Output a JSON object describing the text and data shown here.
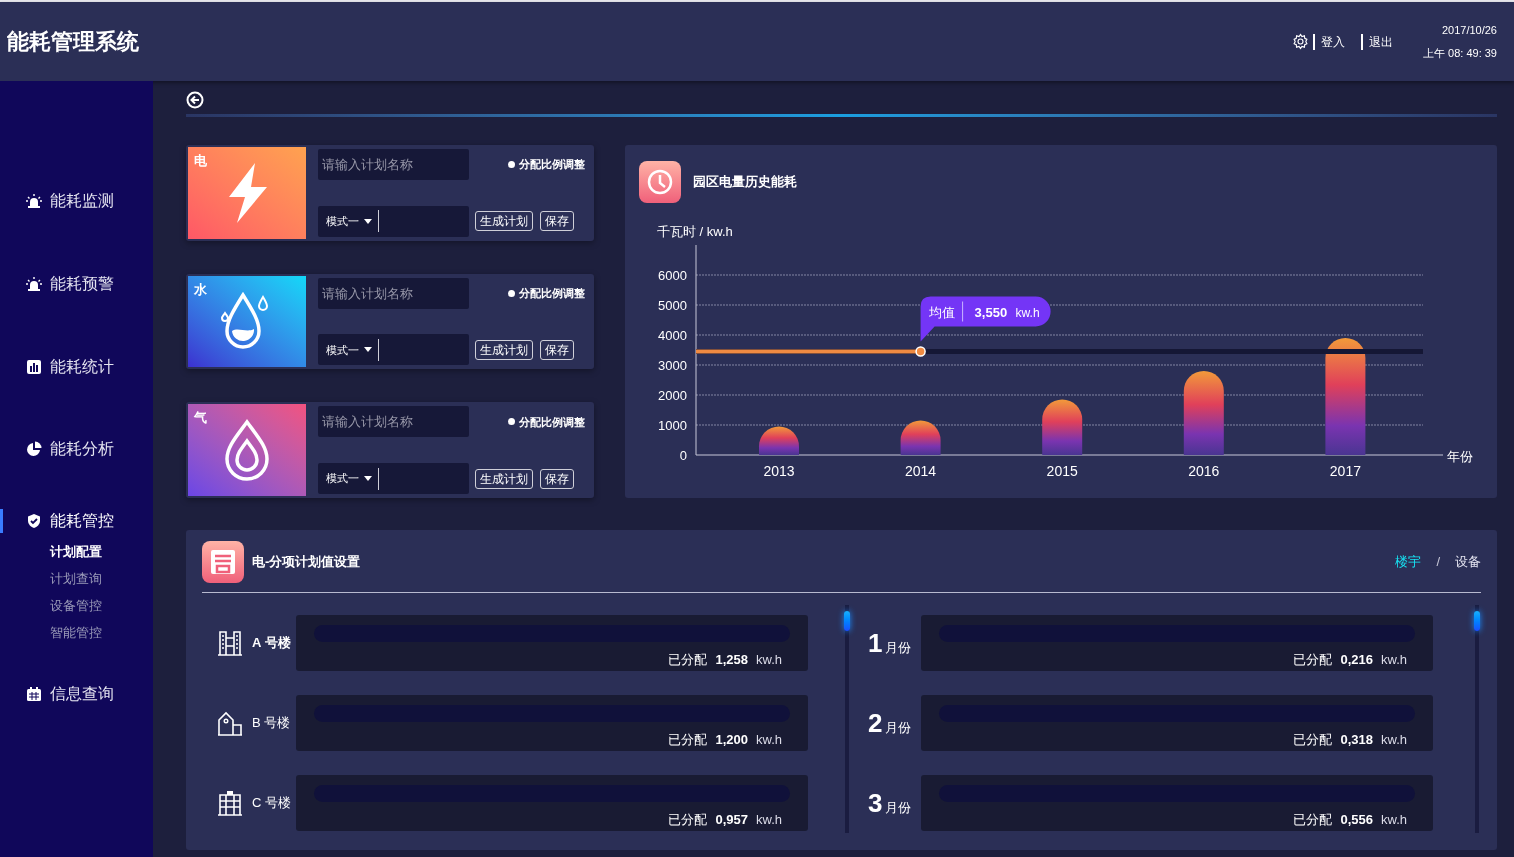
{
  "header": {
    "title": "能耗管理系统",
    "links": [
      "登入",
      "退出"
    ],
    "date": "2017/10/26",
    "time": "上午 08: 49: 39"
  },
  "sidebar": {
    "items": [
      {
        "label": "能耗监测",
        "selected": false
      },
      {
        "label": "能耗预警",
        "selected": false
      },
      {
        "label": "能耗统计",
        "selected": false
      },
      {
        "label": "能耗分析",
        "selected": false
      },
      {
        "label": "能耗管控",
        "selected": true,
        "children": [
          {
            "label": "计划配置",
            "selected": true
          },
          {
            "label": "计划查询",
            "selected": false
          },
          {
            "label": "设备管控",
            "selected": false
          },
          {
            "label": "智能管控",
            "selected": false
          }
        ]
      },
      {
        "label": "信息查询",
        "selected": false
      }
    ]
  },
  "plans": [
    {
      "kind": "electric",
      "tag": "电",
      "name_placeholder": "请输入计划名称",
      "option": {
        "label": "分配比例调整",
        "checked": true
      },
      "mode": "模式一",
      "buttons": [
        "生成计划",
        "保存"
      ]
    },
    {
      "kind": "water",
      "tag": "水",
      "name_placeholder": "请输入计划名称",
      "option": {
        "label": "分配比例调整",
        "checked": true
      },
      "mode": "模式一",
      "buttons": [
        "生成计划",
        "保存"
      ]
    },
    {
      "kind": "gas",
      "tag": "气",
      "name_placeholder": "请输入计划名称",
      "option": {
        "label": "分配比例调整",
        "checked": true
      },
      "mode": "模式一",
      "buttons": [
        "生成计划",
        "保存"
      ]
    }
  ],
  "history": {
    "title": "园区电量历史能耗",
    "chart_data": {
      "type": "bar",
      "ylabel": "千瓦时 / kw.h",
      "xlabel": "年份",
      "categories": [
        "2013",
        "2014",
        "2015",
        "2016",
        "2017"
      ],
      "values": [
        950,
        1150,
        1850,
        2800,
        3900
      ],
      "ylim": [
        0,
        6000
      ],
      "yticks": [
        0,
        1000,
        2000,
        3000,
        4000,
        5000,
        6000
      ],
      "grid": true,
      "ref_lines": [
        {
          "axis": "y",
          "value": 3450,
          "color": "#151735"
        },
        {
          "axis": "y",
          "value": 3450,
          "color": "#ef8a42"
        }
      ],
      "annotations": [
        {
          "text": "均值",
          "x": "2014",
          "y": 3450
        },
        "3,550",
        "kw.h"
      ]
    }
  },
  "allocation": {
    "title": "电-分项计划值设置",
    "tabs": [
      {
        "label": "楼宇",
        "selected": true
      },
      {
        "label": "设备",
        "selected": false
      }
    ],
    "separator": "/",
    "buildings": [
      {
        "name": "A 号楼",
        "allocated_label": "已分配",
        "value": "1,258",
        "unit": "kw.h"
      },
      {
        "name": "B 号楼",
        "allocated_label": "已分配",
        "value": "1,200",
        "unit": "kw.h"
      },
      {
        "name": "C 号楼",
        "allocated_label": "已分配",
        "value": "0,957",
        "unit": "kw.h"
      }
    ],
    "months": [
      {
        "number": "1",
        "unit": "月份",
        "allocated_label": "已分配",
        "value": "0,216",
        "unit_value": "kw.h"
      },
      {
        "number": "2",
        "unit": "月份",
        "allocated_label": "已分配",
        "value": "0,318",
        "unit_value": "kw.h"
      },
      {
        "number": "3",
        "unit": "月份",
        "allocated_label": "已分配",
        "value": "0,556",
        "unit_value": "kw.h"
      }
    ]
  }
}
